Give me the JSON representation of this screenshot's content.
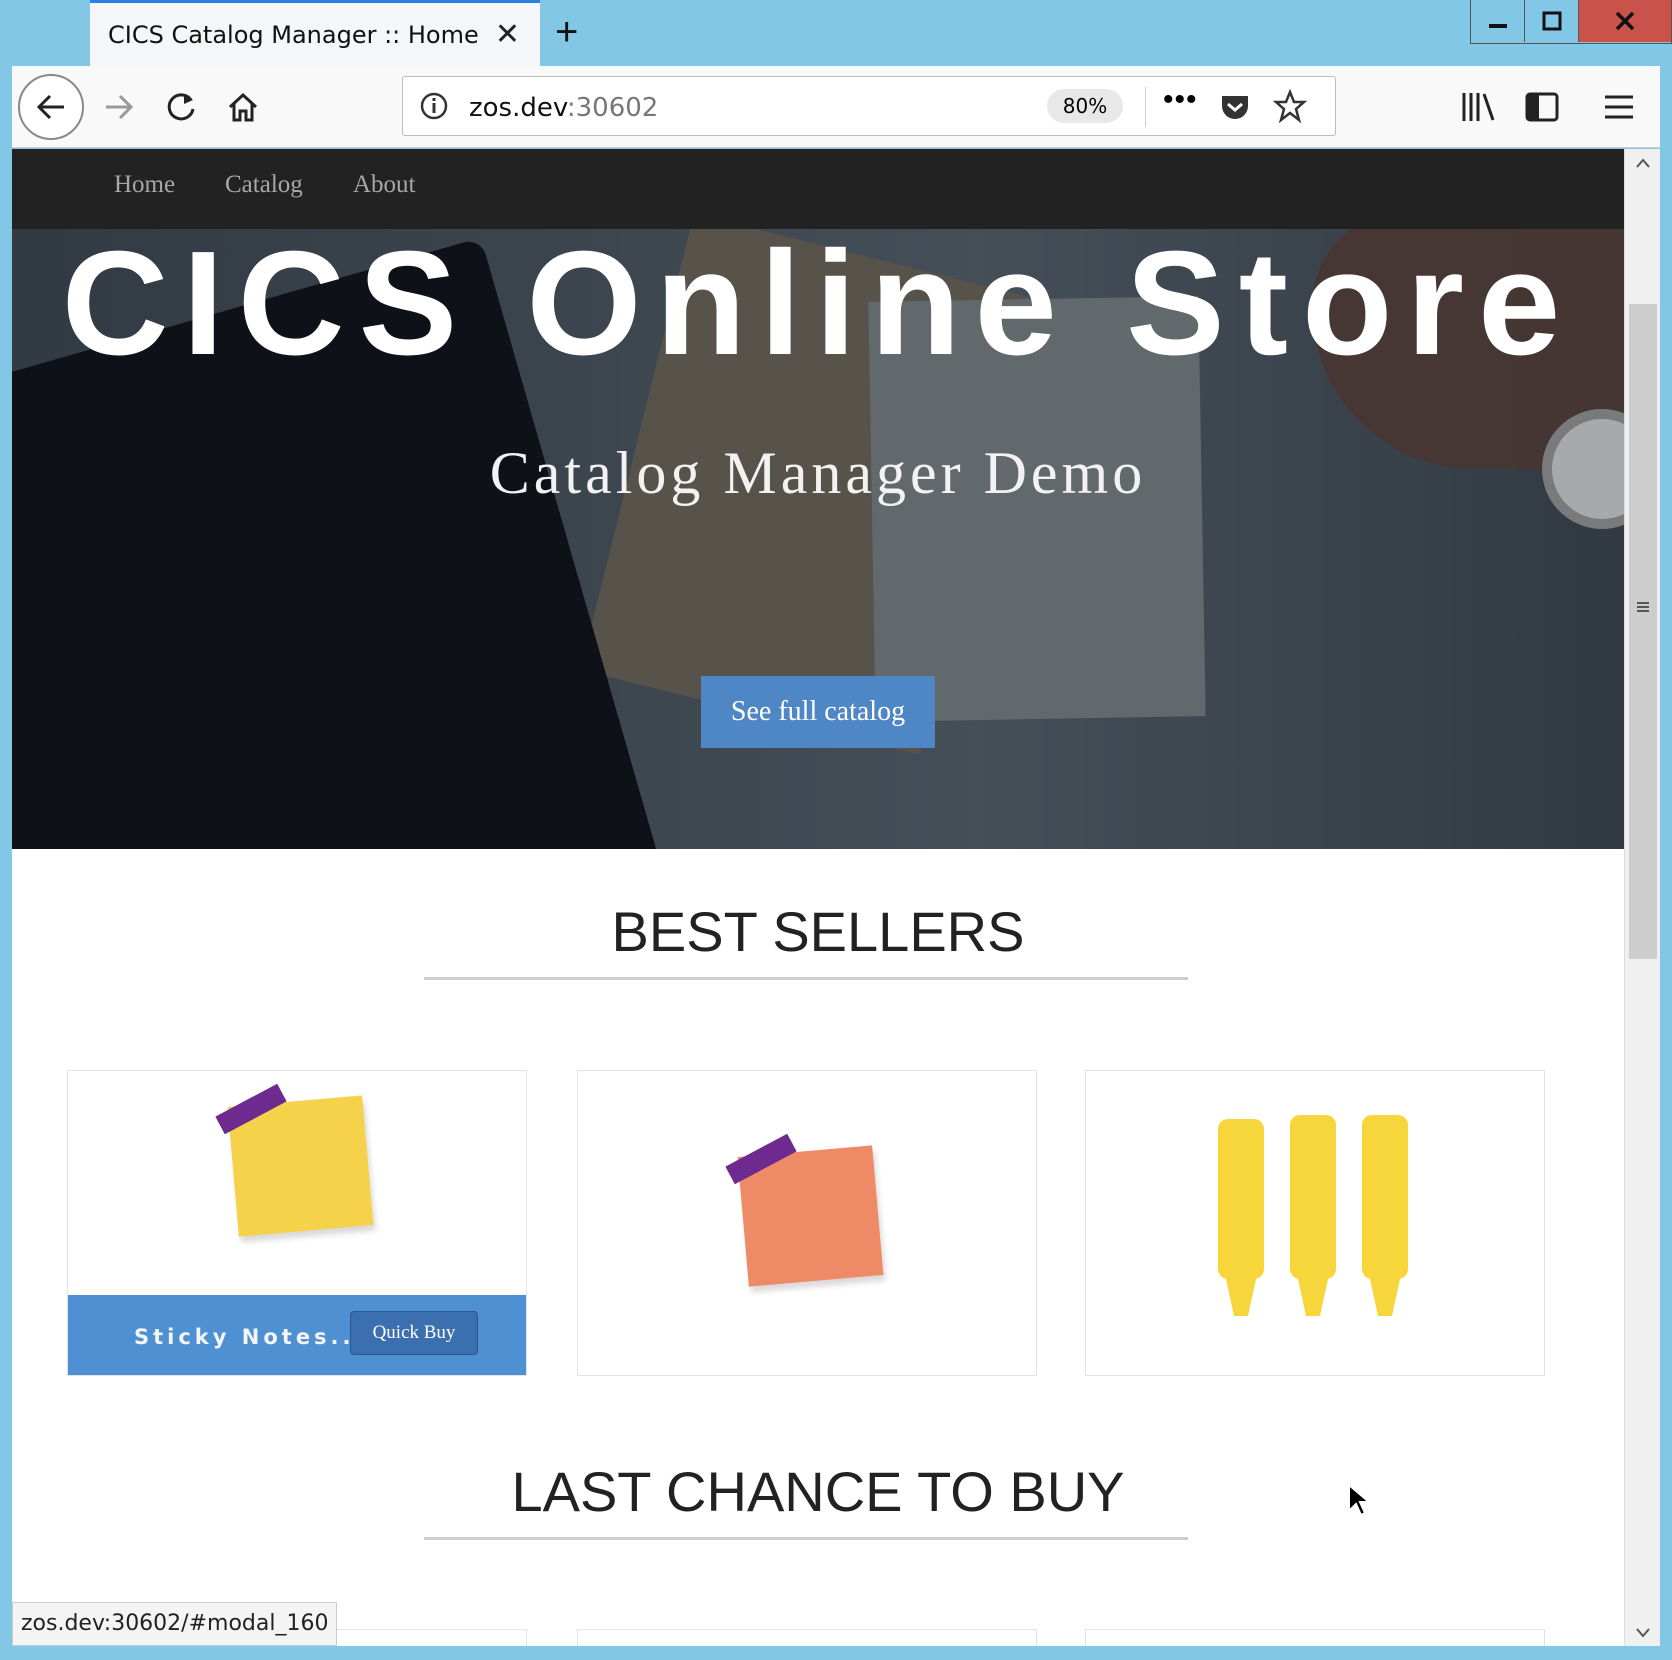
{
  "browser": {
    "tab_title": "CICS Catalog Manager :: Home",
    "url_host": "zos.dev",
    "url_port": ":30602",
    "zoom": "80%",
    "status_url": "zos.dev:30602/#modal_160"
  },
  "site": {
    "nav": [
      "Home",
      "Catalog",
      "About"
    ],
    "hero_title": "CICS Online Store",
    "hero_subtitle": "Catalog Manager Demo",
    "hero_button": "See full catalog",
    "best_sellers_title": "BEST SELLERS",
    "last_chance_title": "LAST CHANCE TO BUY",
    "products": [
      {
        "name": "Sticky Notes...",
        "action": "Quick Buy",
        "image": "yellow-sticky-note",
        "color": "#f6d24a"
      },
      {
        "name": "",
        "action": "",
        "image": "orange-sticky-note",
        "color": "#ee8a66"
      },
      {
        "name": "",
        "action": "",
        "image": "yellow-highlighters",
        "color": "#f7d63c"
      }
    ]
  },
  "colors": {
    "accent": "#4f86c6",
    "nav_bg": "#222222",
    "titlebar": "#82c7e6",
    "close_btn": "#c9524b"
  }
}
